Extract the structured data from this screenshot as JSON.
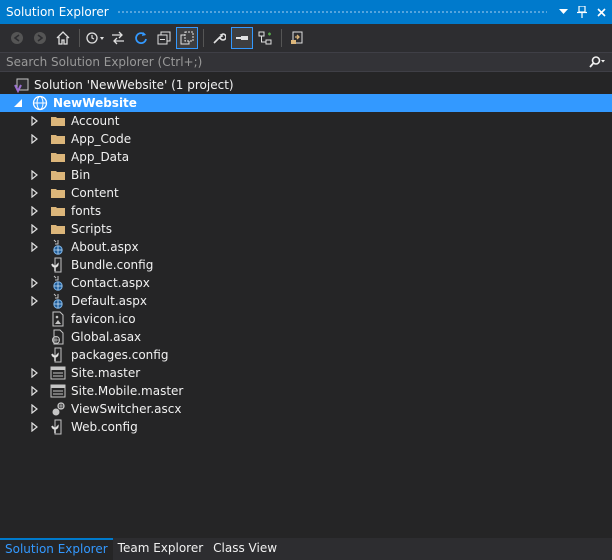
{
  "window": {
    "title": "Solution Explorer"
  },
  "search": {
    "placeholder": "Search Solution Explorer (Ctrl+;)"
  },
  "tree": {
    "solution": "Solution 'NewWebsite' (1 project)",
    "project": "NewWebsite",
    "items": [
      {
        "label": "Account",
        "icon": "folder-icon",
        "expandable": true
      },
      {
        "label": "App_Code",
        "icon": "folder-icon",
        "expandable": true
      },
      {
        "label": "App_Data",
        "icon": "folder-icon",
        "expandable": false
      },
      {
        "label": "Bin",
        "icon": "folder-icon",
        "expandable": true
      },
      {
        "label": "Content",
        "icon": "folder-icon",
        "expandable": true
      },
      {
        "label": "fonts",
        "icon": "folder-icon",
        "expandable": true
      },
      {
        "label": "Scripts",
        "icon": "folder-icon",
        "expandable": true
      },
      {
        "label": "About.aspx",
        "icon": "aspx-file-icon",
        "expandable": true
      },
      {
        "label": "Bundle.config",
        "icon": "config-file-icon",
        "expandable": false
      },
      {
        "label": "Contact.aspx",
        "icon": "aspx-file-icon",
        "expandable": true
      },
      {
        "label": "Default.aspx",
        "icon": "aspx-file-icon",
        "expandable": true
      },
      {
        "label": "favicon.ico",
        "icon": "image-file-icon",
        "expandable": false
      },
      {
        "label": "Global.asax",
        "icon": "asax-file-icon",
        "expandable": false
      },
      {
        "label": "packages.config",
        "icon": "config-file-icon",
        "expandable": false
      },
      {
        "label": "Site.master",
        "icon": "master-file-icon",
        "expandable": true
      },
      {
        "label": "Site.Mobile.master",
        "icon": "master-file-icon",
        "expandable": true
      },
      {
        "label": "ViewSwitcher.ascx",
        "icon": "ascx-file-icon",
        "expandable": true
      },
      {
        "label": "Web.config",
        "icon": "config-file-icon",
        "expandable": true
      }
    ]
  },
  "tabs": [
    {
      "label": "Solution Explorer",
      "active": true
    },
    {
      "label": "Team Explorer",
      "active": false
    },
    {
      "label": "Class View",
      "active": false
    }
  ],
  "colors": {
    "accent": "#007acc",
    "selection": "#3399ff",
    "background": "#252526",
    "folder": "#dcb67a"
  }
}
